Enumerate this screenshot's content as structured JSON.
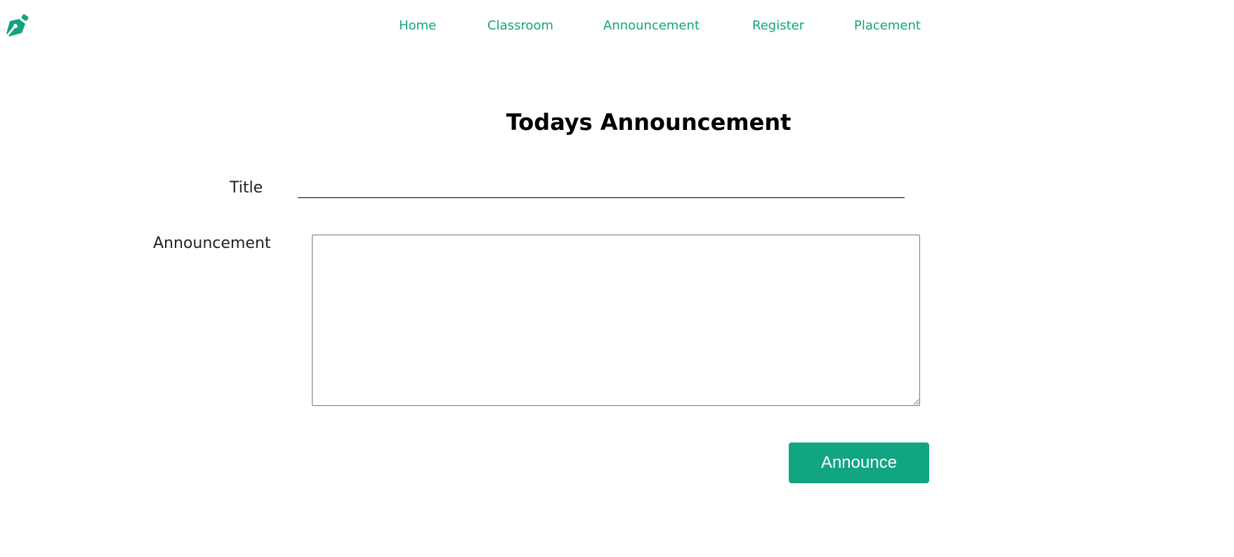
{
  "logo": {
    "icon": "pen-nib-icon",
    "color": "#14a37e"
  },
  "nav": {
    "items": [
      {
        "label": "Home"
      },
      {
        "label": "Classroom"
      },
      {
        "label": "Announcement"
      },
      {
        "label": "Register"
      },
      {
        "label": "Placement"
      }
    ]
  },
  "main": {
    "title": "Todays Announcement",
    "form": {
      "title_label": "Title",
      "title_value": "",
      "announcement_label": "Announcement",
      "announcement_value": "",
      "submit_label": "Announce"
    }
  },
  "colors": {
    "accent": "#14a37e",
    "button": "#12a581",
    "button_text": "#ffffff"
  }
}
